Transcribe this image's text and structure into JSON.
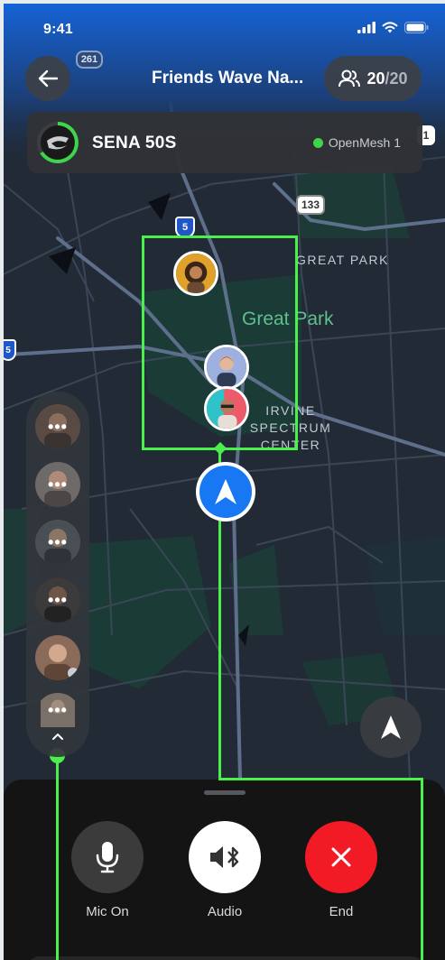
{
  "status_bar": {
    "time": "9:41"
  },
  "header": {
    "title": "Friends Wave Na...",
    "member_count": "20",
    "member_total": "/20"
  },
  "device": {
    "name": "SENA 50S",
    "mesh_label": "OpenMesh 1"
  },
  "map_labels": {
    "route_261": "261",
    "route_133": "133",
    "route_5": "5",
    "route_5_left": "5",
    "route_1_right": "1",
    "great_park_caps": "GREAT PARK",
    "great_park": "Great Park",
    "irvine_line1": "IRVINE",
    "irvine_line2": "SPECTRUM",
    "irvine_line3": "CENTER"
  },
  "rail": {
    "item_dots": "•••"
  },
  "controls": {
    "mic_label": "Mic On",
    "audio_label": "Audio",
    "end_label": "End"
  },
  "colors": {
    "accent_green": "#4cf04c",
    "nav_blue": "#1877f2",
    "end_red": "#f21b25",
    "online_green": "#3fd54b"
  }
}
